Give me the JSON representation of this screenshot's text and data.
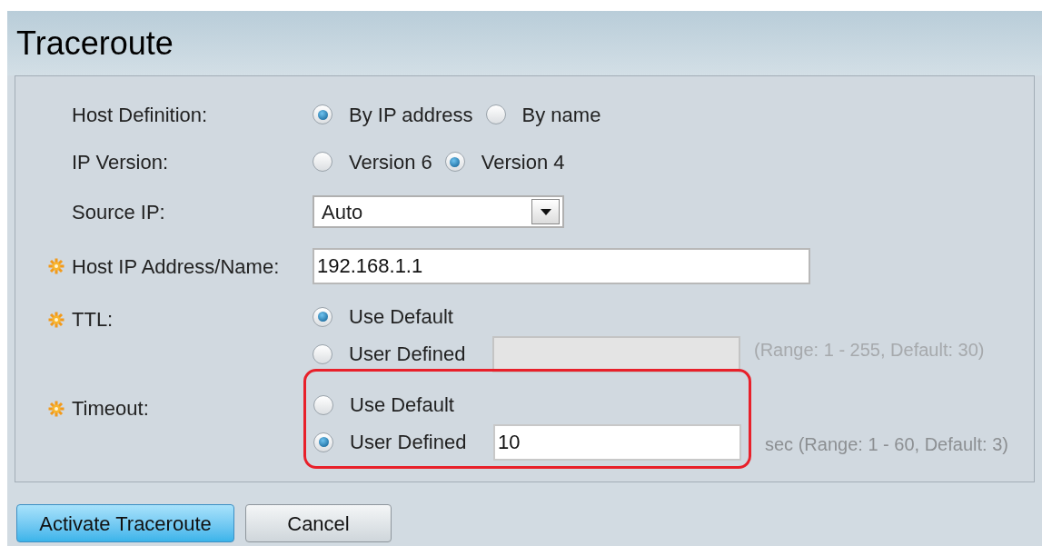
{
  "title": "Traceroute",
  "fields": [
    {
      "kind": "radio",
      "label": "Host Definition:",
      "required": false,
      "options": [
        {
          "label": "By IP address",
          "selected": true
        },
        {
          "label": "By name",
          "selected": false
        }
      ]
    },
    {
      "kind": "radio",
      "label": "IP Version:",
      "required": false,
      "options": [
        {
          "label": "Version 6",
          "selected": false
        },
        {
          "label": "Version 4",
          "selected": true
        }
      ]
    },
    {
      "kind": "select",
      "label": "Source IP:",
      "required": false,
      "value": "Auto"
    },
    {
      "kind": "text",
      "label": "Host IP Address/Name:",
      "required": true,
      "value": "192.168.1.1"
    },
    {
      "kind": "choice",
      "label": "TTL:",
      "required": true,
      "highlighted": false,
      "options": [
        {
          "label": "Use Default",
          "selected": true
        },
        {
          "label": "User Defined",
          "selected": false,
          "disabled": true
        }
      ],
      "hint": "(Range: 1 - 255, Default: 30)",
      "hint_disabled": true
    },
    {
      "kind": "choice",
      "label": "Timeout:",
      "required": true,
      "highlighted": true,
      "options": [
        {
          "label": "Use Default",
          "selected": false
        },
        {
          "label": "User Defined",
          "selected": true,
          "disabled": false,
          "value": "10"
        }
      ],
      "hint": "sec (Range: 1 - 60, Default: 3)",
      "hint_disabled": false
    }
  ],
  "buttons": [
    {
      "label": "Activate Traceroute",
      "primary": true
    },
    {
      "label": "Cancel",
      "primary": false
    }
  ]
}
